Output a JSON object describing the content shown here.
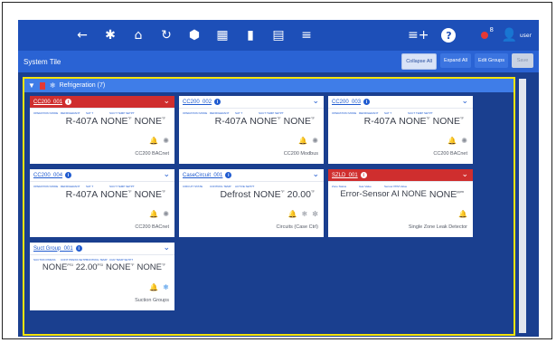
{
  "topbar": {
    "nav_icons": [
      "back-icon",
      "settings-icon",
      "home-icon",
      "refresh-icon",
      "globe-icon",
      "calendar-icon",
      "map-icon",
      "report-icon",
      "list-icon"
    ],
    "nav_glyphs": [
      "←",
      "✱",
      "⌂",
      "↻",
      "⬢",
      "▦",
      "▮",
      "▤",
      "≡"
    ],
    "add_glyph": "≡+",
    "help_glyph": "?",
    "alarm_count": "8",
    "user_glyph": "👤",
    "user_label": "user"
  },
  "subbar": {
    "title": "System Tile",
    "buttons": [
      "Collapse All",
      "Expand All",
      "Edit Groups",
      "Save"
    ]
  },
  "group": {
    "title": "Refrigeration (7)"
  },
  "cards": [
    {
      "title": "CC200_001",
      "red": true,
      "labels": [
        "OPERATION MODE",
        "REFRIGERANT",
        "SAT T",
        "SUCT TEMP SETPT"
      ],
      "values": [
        "R-407A",
        "NONE",
        "NONE"
      ],
      "value_sups": [
        "",
        "°F",
        "°F"
      ],
      "icons": [
        "alarm-icon",
        "fan-icon"
      ],
      "footer": "CC200 BACnet"
    },
    {
      "title": "CC200_002",
      "red": false,
      "labels": [
        "OPERATION MODE",
        "REFRIGERANT",
        "SAT T",
        "SUCT TEMP SETPT"
      ],
      "values": [
        "R-407A",
        "NONE",
        "NONE"
      ],
      "value_sups": [
        "",
        "°F",
        "°F"
      ],
      "icons": [
        "bell-icon",
        "fan-icon"
      ],
      "footer": "CC200 Modbus"
    },
    {
      "title": "CC200_003",
      "red": false,
      "labels": [
        "OPERATION MODE",
        "REFRIGERANT",
        "SAT T",
        "SUCT TEMP SETPT"
      ],
      "values": [
        "R-407A",
        "NONE",
        "NONE"
      ],
      "value_sups": [
        "",
        "°F",
        "°F"
      ],
      "icons": [
        "bell-icon",
        "fan-icon"
      ],
      "footer": "CC200 BACnet"
    },
    {
      "title": "CC200_004",
      "red": false,
      "labels": [
        "OPERATION MODE",
        "REFRIGERANT",
        "SAT T",
        "SUCT TEMP SETPT"
      ],
      "values": [
        "R-407A",
        "NONE",
        "NONE"
      ],
      "value_sups": [
        "",
        "°F",
        "°F"
      ],
      "icons": [
        "bell-icon",
        "fan-icon"
      ],
      "footer": "CC200 BACnet"
    },
    {
      "title": "CaseCircuit_001",
      "red": false,
      "labels": [
        "CIRCUIT STATE",
        "CONTROL TEMP",
        "ACTIVE SETPT"
      ],
      "values": [
        "Defrost",
        "NONE",
        "20.00"
      ],
      "value_sups": [
        "",
        "°F",
        "°F"
      ],
      "icons": [
        "bell-icon",
        "snowflake-icon",
        "defrost-icon"
      ],
      "footer": "Circuits (Case Ctrl)"
    },
    {
      "title": "SZLD_001",
      "red": true,
      "labels": [
        "Zone Status",
        "Gas Value",
        "Sensor PPM Value"
      ],
      "values": [
        "Error-Sensor AI NONE",
        "NONE"
      ],
      "value_sups": [
        "",
        "ppm"
      ],
      "icons": [
        "alarm-icon"
      ],
      "footer": "Single Zone Leak Detector"
    },
    {
      "title": "Suct Group_001",
      "red": false,
      "labels": [
        "SUCTION PRESS",
        "CONT PRESS SETPT",
        "CONTROL TEMP",
        "CUR TEMP SETPT"
      ],
      "values": [
        "NONE",
        "22.00",
        "NONE",
        "NONE"
      ],
      "value_sups": [
        "PSI",
        "PSI",
        "°F",
        "°F"
      ],
      "icons": [
        "bell-icon",
        "snowflake-icon"
      ],
      "footer": "Suction Groups"
    }
  ]
}
